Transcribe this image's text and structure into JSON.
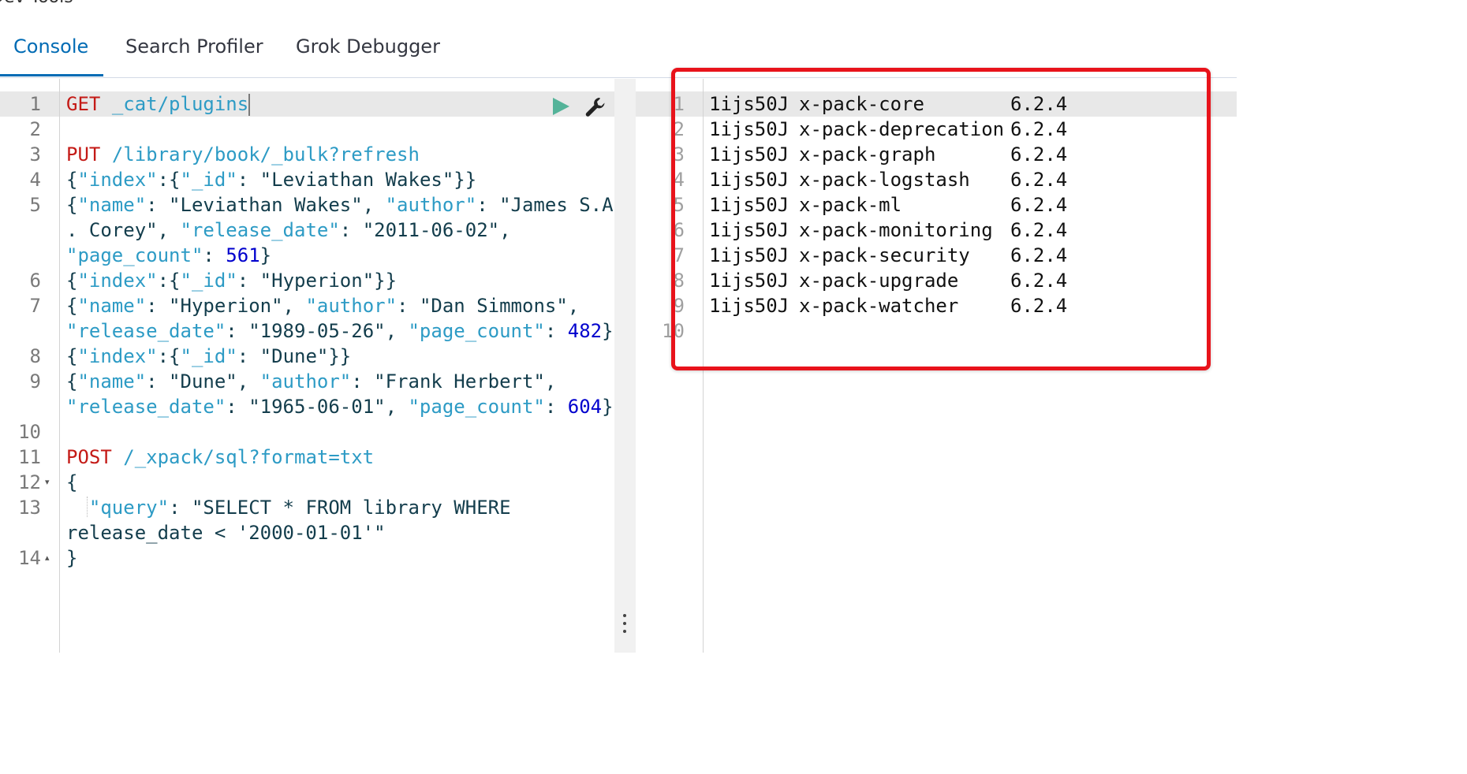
{
  "page": {
    "title": "Dev Tools"
  },
  "tabs": [
    {
      "label": "Console",
      "active": true
    },
    {
      "label": "Search Profiler",
      "active": false
    },
    {
      "label": "Grok Debugger",
      "active": false
    }
  ],
  "editor": {
    "lines": [
      {
        "num": "1",
        "fold": "",
        "code": "GET _cat/plugins"
      },
      {
        "num": "2",
        "fold": "",
        "code": ""
      },
      {
        "num": "3",
        "fold": "",
        "code": "PUT /library/book/_bulk?refresh"
      },
      {
        "num": "4",
        "fold": "",
        "code": "{\"index\":{\"_id\": \"Leviathan Wakes\"}}"
      },
      {
        "num": "5",
        "fold": "",
        "code": "{\"name\": \"Leviathan Wakes\", \"author\": \"James S.A"
      },
      {
        "num": "",
        "fold": "",
        "code": ". Corey\", \"release_date\": \"2011-06-02\","
      },
      {
        "num": "",
        "fold": "",
        "code": "\"page_count\": 561}"
      },
      {
        "num": "6",
        "fold": "",
        "code": "{\"index\":{\"_id\": \"Hyperion\"}}"
      },
      {
        "num": "7",
        "fold": "",
        "code": "{\"name\": \"Hyperion\", \"author\": \"Dan Simmons\","
      },
      {
        "num": "",
        "fold": "",
        "code": "\"release_date\": \"1989-05-26\", \"page_count\": 482}"
      },
      {
        "num": "8",
        "fold": "",
        "code": "{\"index\":{\"_id\": \"Dune\"}}"
      },
      {
        "num": "9",
        "fold": "",
        "code": "{\"name\": \"Dune\", \"author\": \"Frank Herbert\","
      },
      {
        "num": "",
        "fold": "",
        "code": "\"release_date\": \"1965-06-01\", \"page_count\": 604}"
      },
      {
        "num": "10",
        "fold": "",
        "code": ""
      },
      {
        "num": "11",
        "fold": "",
        "code": "POST /_xpack/sql?format=txt"
      },
      {
        "num": "12",
        "fold": "▾",
        "code": "{"
      },
      {
        "num": "13",
        "fold": "",
        "code": "  \"query\": \"SELECT * FROM library WHERE"
      },
      {
        "num": "",
        "fold": "",
        "code": "release_date < '2000-01-01'\""
      },
      {
        "num": "14",
        "fold": "▴",
        "code": "}"
      }
    ]
  },
  "output": {
    "rows": [
      {
        "num": "1",
        "node": "1ijs50J",
        "component": "x-pack-core",
        "version": "6.2.4"
      },
      {
        "num": "2",
        "node": "1ijs50J",
        "component": "x-pack-deprecation",
        "version": "6.2.4"
      },
      {
        "num": "3",
        "node": "1ijs50J",
        "component": "x-pack-graph",
        "version": "6.2.4"
      },
      {
        "num": "4",
        "node": "1ijs50J",
        "component": "x-pack-logstash",
        "version": "6.2.4"
      },
      {
        "num": "5",
        "node": "1ijs50J",
        "component": "x-pack-ml",
        "version": "6.2.4"
      },
      {
        "num": "6",
        "node": "1ijs50J",
        "component": "x-pack-monitoring",
        "version": "6.2.4"
      },
      {
        "num": "7",
        "node": "1ijs50J",
        "component": "x-pack-security",
        "version": "6.2.4"
      },
      {
        "num": "8",
        "node": "1ijs50J",
        "component": "x-pack-upgrade",
        "version": "6.2.4"
      },
      {
        "num": "9",
        "node": "1ijs50J",
        "component": "x-pack-watcher",
        "version": "6.2.4"
      }
    ],
    "last_line_num": "10"
  },
  "icons": {
    "run": "play-icon",
    "settings": "wrench-icon",
    "resize": "vertical-dots-icon"
  },
  "colors": {
    "accent": "#006bb4",
    "method": "#c41a16",
    "url": "#2d9bc5",
    "number": "#0000cd",
    "highlight": "#e8131b",
    "run": "#54b399"
  }
}
